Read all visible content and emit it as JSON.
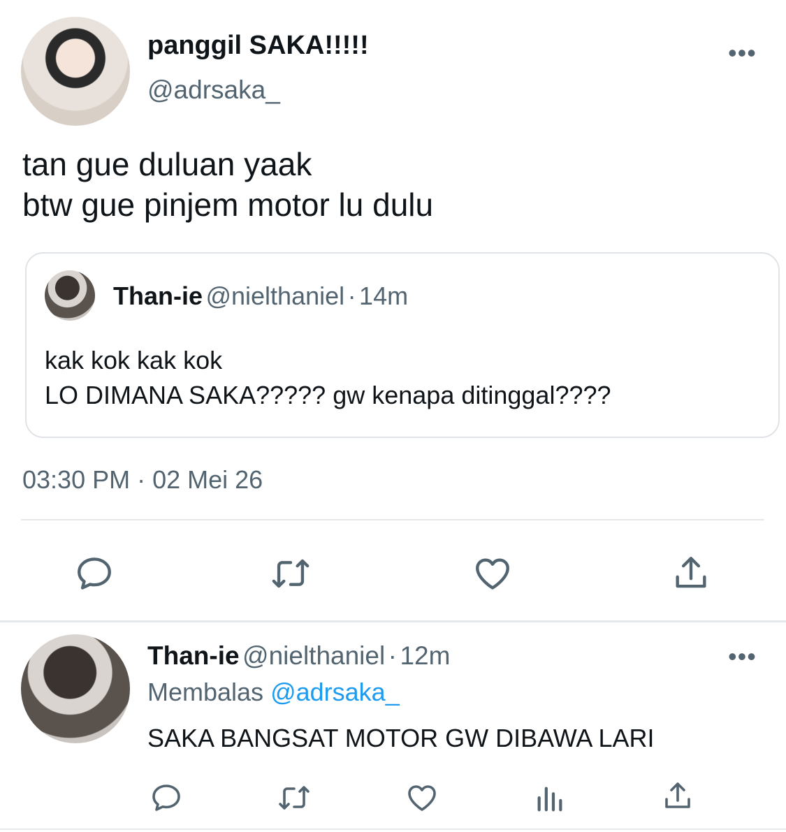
{
  "main_tweet": {
    "display_name": "panggil SAKA!!!!!",
    "handle": "@adrsaka_",
    "text": "tan gue duluan yaak\nbtw gue pinjem motor lu dulu",
    "timestamp": "03:30 PM · 02 Mei 26"
  },
  "quoted_tweet": {
    "display_name": "Than-ie",
    "handle": "@nielthaniel",
    "separator": "·",
    "time": "14m",
    "text": "kak kok kak kok\nLO DIMANA SAKA????? gw kenapa ditinggal????"
  },
  "reply_tweet": {
    "display_name": "Than-ie",
    "handle": "@nielthaniel",
    "separator": "·",
    "time": "12m",
    "replying_label": "Membalas",
    "replying_to": "@adrsaka_",
    "text": "SAKA BANGSAT MOTOR GW DIBAWA LARI"
  },
  "more_glyph": "•••",
  "icons": [
    "more-icon",
    "reply-icon",
    "retweet-icon",
    "like-icon",
    "share-icon",
    "analytics-icon"
  ],
  "colors": {
    "text": "#0f1419",
    "secondary": "#536471",
    "link": "#1d9bf0",
    "border": "#dfe3e7"
  }
}
